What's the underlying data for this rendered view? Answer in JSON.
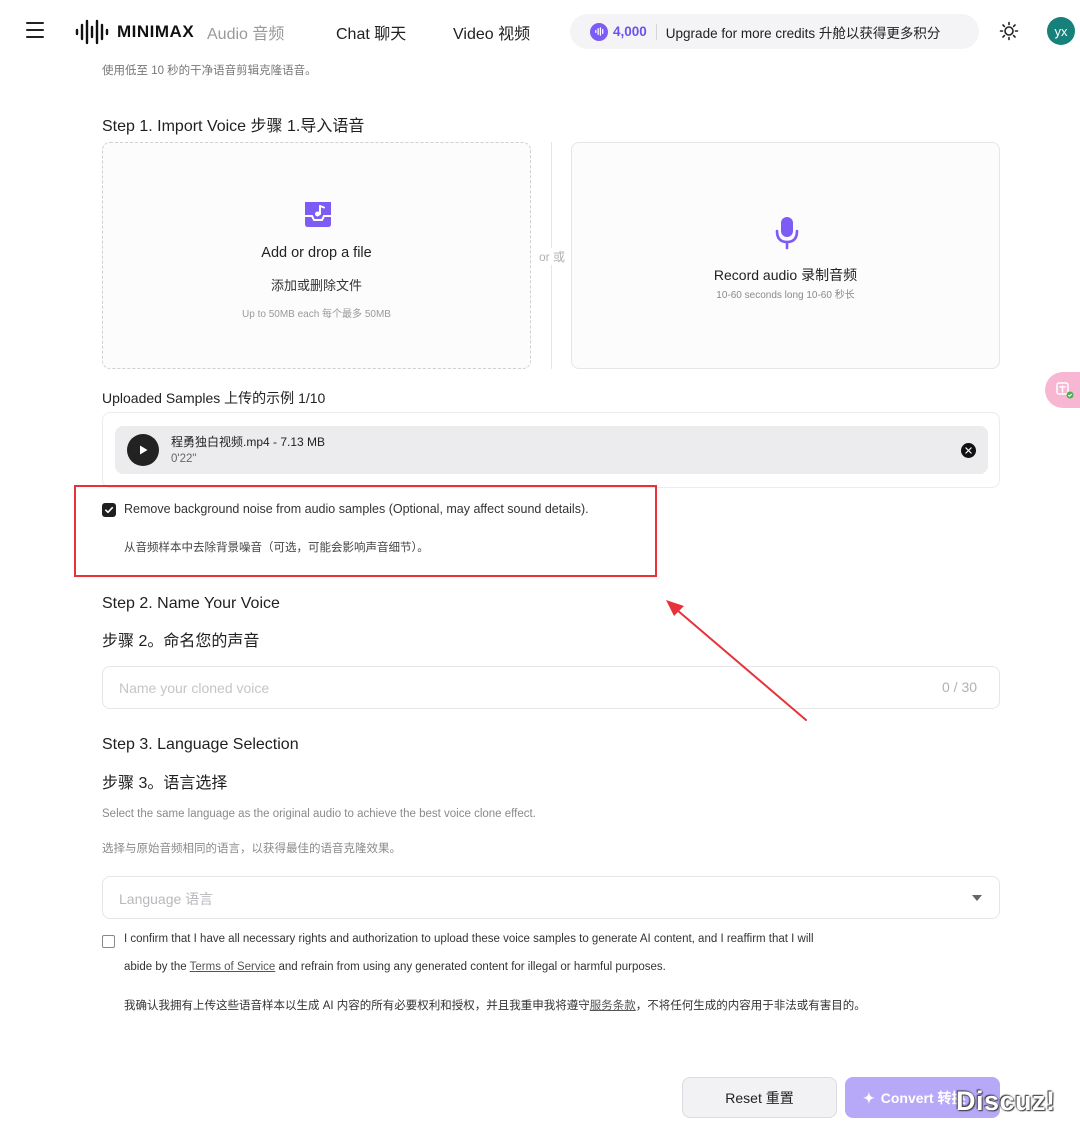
{
  "header": {
    "brand": "MINIMAX",
    "nav": {
      "audio": "Audio  音频",
      "chat": "Chat  聊天",
      "video": "Video  视频"
    },
    "credits": {
      "amount": "4,000",
      "upgrade_text": "Upgrade for more credits  升舱以获得更多积分"
    },
    "avatar_initials": "yx",
    "icons": [
      "menu-icon",
      "sun-icon",
      "voice-wave-icon"
    ],
    "accent_color": "#7c5cf5"
  },
  "intro": "使用低至 10 秒的干净语音剪辑克隆语音。",
  "step1": {
    "title": "Step 1. Import Voice  步骤 1.导入语音",
    "dropzone": {
      "title": "Add or drop a file",
      "title_cn": "添加或删除文件",
      "limit": "Up to 50MB each  每个最多 50MB"
    },
    "or_label": "or  或",
    "record": {
      "title": "Record audio  录制音频",
      "subtitle": "10-60 seconds long  10-60 秒长"
    }
  },
  "samples": {
    "label": "Uploaded Samples  上传的示例  1/10",
    "items": [
      {
        "name": "程勇独白视频.mp4 - 7.13 MB",
        "duration": "0'22\""
      }
    ]
  },
  "noise": {
    "checked": true,
    "label": "Remove background noise from audio samples (Optional, may affect sound details).",
    "label_cn": "从音频样本中去除背景噪音（可选，可能会影响声音细节）。",
    "highlight_color": "#e8323a"
  },
  "step2": {
    "title": "Step 2. Name Your Voice",
    "title_cn": "步骤 2。命名您的声音",
    "input_value": "",
    "placeholder": "Name your cloned voice",
    "char_count": "0 / 30"
  },
  "step3": {
    "title": "Step 3. Language Selection",
    "title_cn": "步骤 3。语言选择",
    "description": "Select the same language as the original audio to achieve the best voice clone effect.",
    "description_cn": "选择与原始音频相同的语言，以获得最佳的语音克隆效果。",
    "select_placeholder": "Language  语言"
  },
  "terms": {
    "checked": false,
    "line1": "I confirm that I have all necessary rights and authorization to upload these voice samples to generate AI content, and I reaffirm that I will",
    "line2_before": "abide by the ",
    "line2_link": "Terms of Service",
    "line2_after": " and refrain from using any generated content for illegal or harmful purposes.",
    "line3_before": "我确认我拥有上传这些语音样本以生成 AI 内容的所有必要权利和授权，并且我重申我将遵守",
    "line3_link": "服务条款",
    "line3_after": "，不将任何生成的内容用于非法或有害目的。"
  },
  "actions": {
    "reset": "Reset  重置",
    "convert": "Convert  转换"
  },
  "watermark": "Discuz!"
}
